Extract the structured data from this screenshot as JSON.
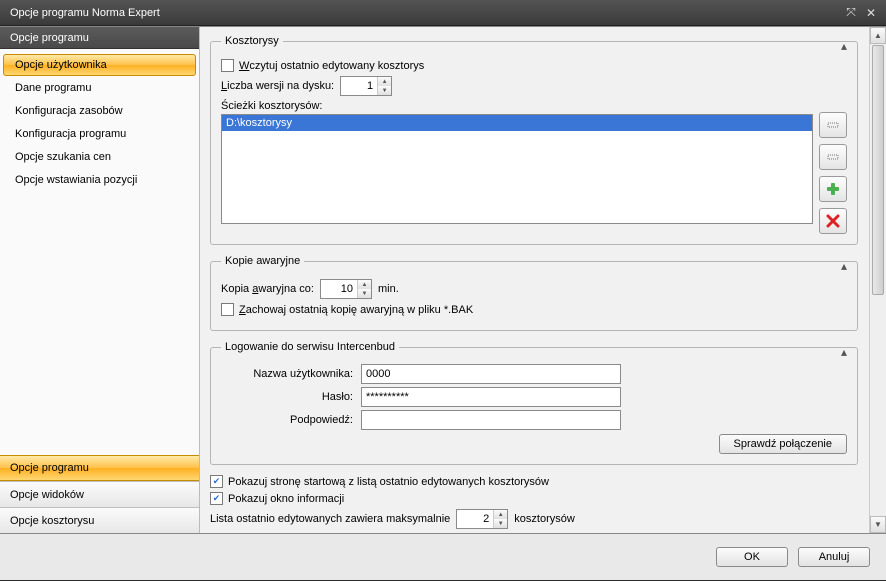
{
  "window": {
    "title": "Opcje programu Norma Expert"
  },
  "sidebar": {
    "header": "Opcje programu",
    "items": [
      "Opcje użytkownika",
      "Dane programu",
      "Konfiguracja zasobów",
      "Konfiguracja programu",
      "Opcje szukania cen",
      "Opcje wstawiania pozycji"
    ],
    "selectedIndex": 0,
    "groups": [
      "Opcje programu",
      "Opcje widoków",
      "Opcje kosztorysu"
    ],
    "selectedGroupIndex": 0
  },
  "kosztorysy": {
    "legend": "Kosztorysy",
    "loadLastLabel_pre": "",
    "loadLastLabel_underline": "W",
    "loadLastLabel_post": "czytuj ostatnio edytowany kosztorys",
    "loadLastChecked": false,
    "versionsLabel_pre": "",
    "versionsLabel_underline": "L",
    "versionsLabel_post": "iczba wersji na dysku:",
    "versionsValue": "1",
    "pathsLabel": "Ścieżki kosztorysów:",
    "paths": [
      "D:\\kosztorysy"
    ]
  },
  "backup": {
    "legend": "Kopie awaryjne",
    "everyLabel_pre": "Kopia ",
    "everyLabel_underline": "a",
    "everyLabel_post": "waryjna co:",
    "everyValue": "10",
    "unit": "min.",
    "keepLabel_pre": "",
    "keepLabel_underline": "Z",
    "keepLabel_post": "achowaj ostatnią kopię awaryjną w pliku *.BAK",
    "keepChecked": false
  },
  "login": {
    "legend": "Logowanie do serwisu Intercenbud",
    "userLabel": "Nazwa użytkownika:",
    "userValue": "0000",
    "passLabel": "Hasło:",
    "passValue": "**********",
    "hintLabel": "Podpowiedź:",
    "hintValue": "",
    "checkBtn": "Sprawdź połączenie"
  },
  "bottom": {
    "showStartLabel": "Pokazuj stronę startową z listą ostatnio edytowanych kosztorysów",
    "showStartChecked": true,
    "showInfoLabel": "Pokazuj okno informacji",
    "showInfoChecked": true,
    "listMaxPre": "Lista ostatnio edytowanych zawiera maksymalnie",
    "listMaxValue": "2",
    "listMaxPost": "kosztorysów"
  },
  "footer": {
    "ok": "OK",
    "cancel": "Anuluj"
  }
}
